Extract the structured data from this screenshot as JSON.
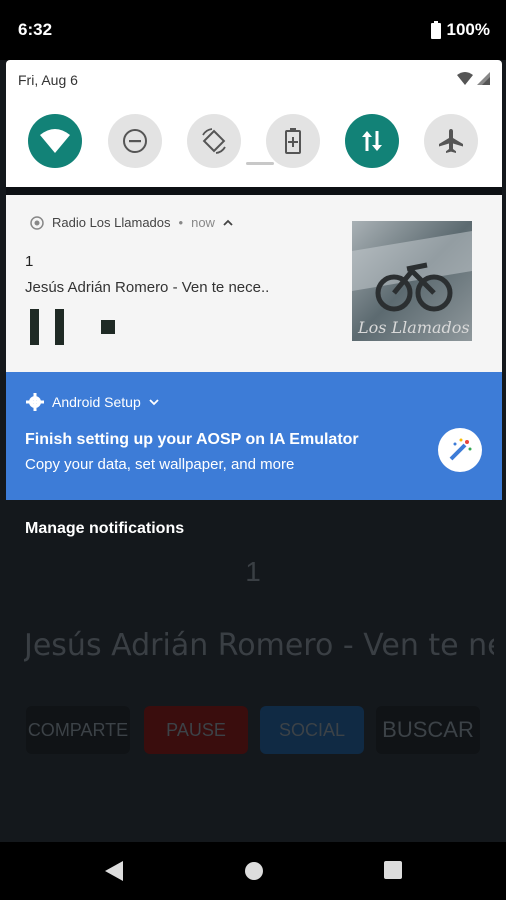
{
  "status_bar": {
    "time": "6:32",
    "battery": "100%"
  },
  "quick_settings": {
    "date": "Fri, Aug 6"
  },
  "media_notification": {
    "app_name": "Radio Los Llamados",
    "separator": "•",
    "when": "now",
    "track_number": "1",
    "artist_title": "Jesús Adrián Romero - Ven te nece..",
    "album_art_text": "Los Llamados"
  },
  "setup_notification": {
    "app_name": "Android Setup",
    "title": "Finish setting up your AOSP on IA Emulator",
    "subtitle": "Copy your data, set wallpaper, and more"
  },
  "manage_label": "Manage notifications",
  "background_app": {
    "track_number": "1",
    "song": "Jesús Adrián Romero - Ven te necesito (..",
    "buttons": [
      "COMPARTE",
      "PAUSE",
      "SOCIAL",
      "BUSCAR"
    ]
  },
  "colors": {
    "accent": "#128277",
    "setup_blue": "#3d7cd7"
  }
}
